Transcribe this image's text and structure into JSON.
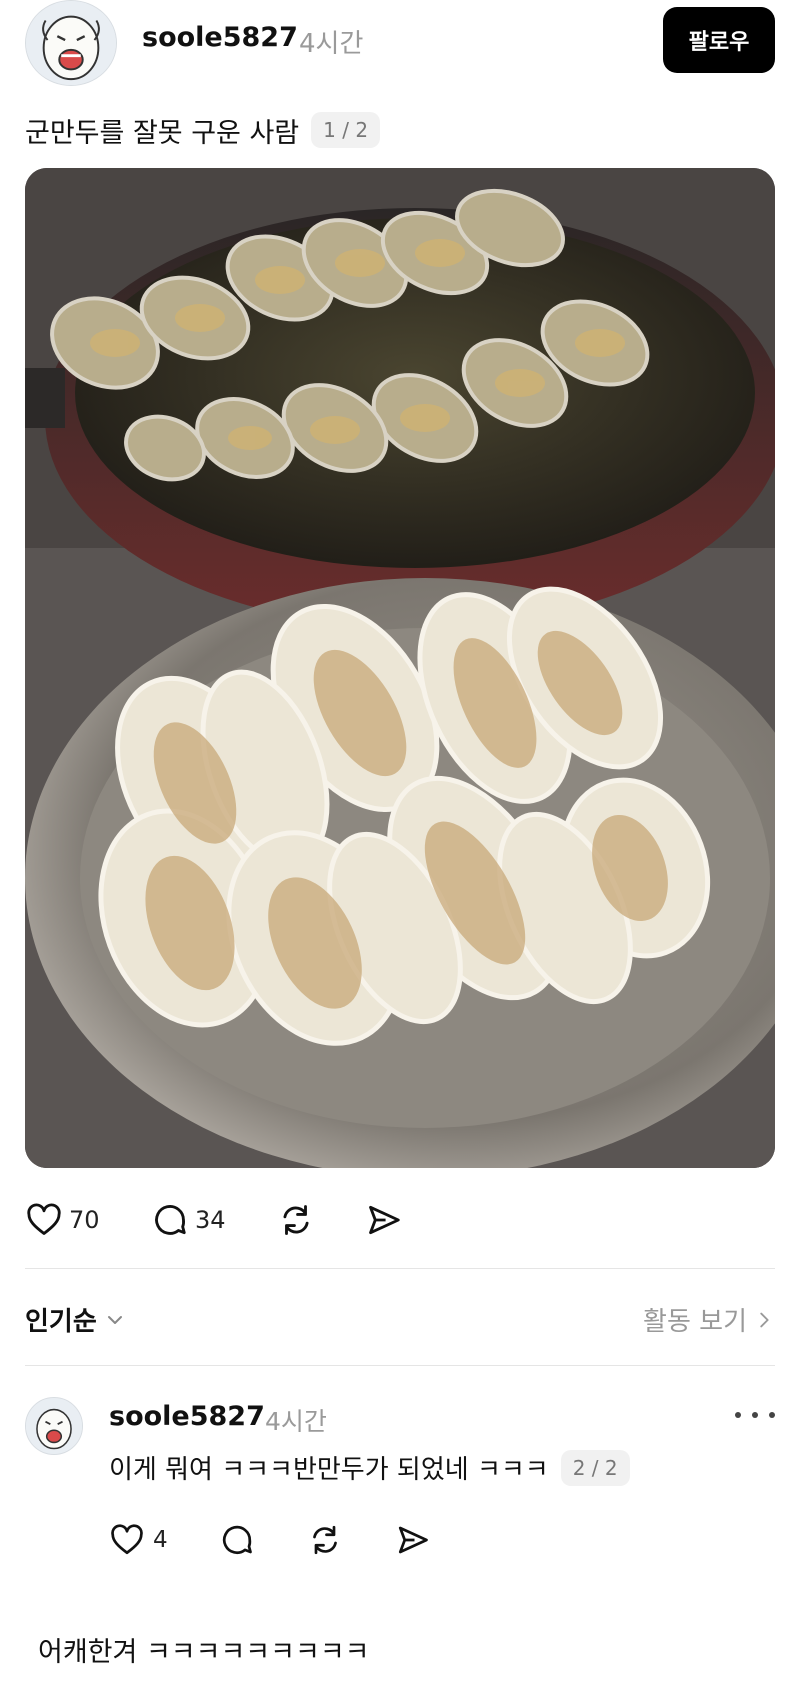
{
  "post": {
    "username": "soole5827",
    "time": "4시간",
    "follow_label": "팔로우",
    "caption": "군만두를 잘못 구운 사람",
    "page_indicator": "1 / 2",
    "likes": "70",
    "comments": "34"
  },
  "sort": {
    "label": "인기순",
    "activity_link": "활동 보기"
  },
  "comment": {
    "username": "soole5827",
    "time": "4시간",
    "text": "이게 뭐여 ㅋㅋㅋ반만두가 되었네 ㅋㅋㅋ",
    "page_indicator": "2 / 2",
    "likes": "4"
  },
  "next_post": {
    "text": "어캐한겨 ㅋㅋㅋㅋㅋㅋㅋㅋㅋ"
  },
  "icons": {
    "like": "heart-icon",
    "comment": "speech-bubble-icon",
    "repost": "repost-icon",
    "share": "send-icon",
    "sort": "chevron-down-icon",
    "activity": "chevron-right-icon",
    "more": "more-dots-icon"
  }
}
